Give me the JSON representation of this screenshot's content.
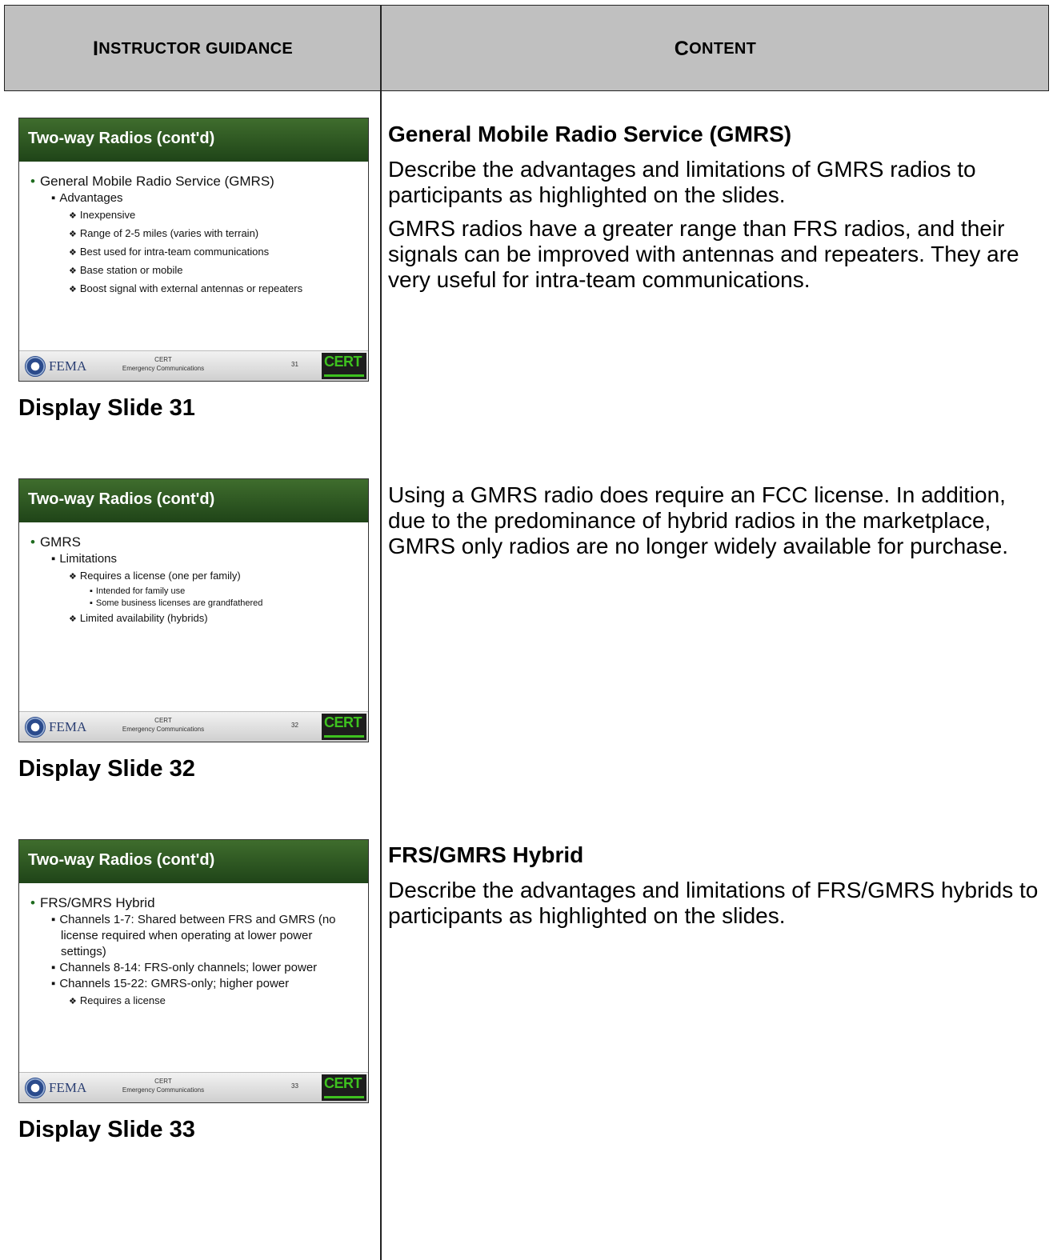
{
  "header": {
    "left": {
      "cap1": "I",
      "rest1": "nstructor guidance"
    },
    "right": {
      "cap1": "C",
      "rest1": "ontent"
    }
  },
  "slides": [
    {
      "title": "Two-way Radios (cont'd)",
      "bullets": [
        {
          "level": 1,
          "text": "General Mobile Radio Service (GMRS)"
        },
        {
          "level": 2,
          "text": "Advantages"
        },
        {
          "level": 3,
          "text": "Inexpensive"
        },
        {
          "level": 3,
          "text": "Range of 2-5 miles (varies with terrain)"
        },
        {
          "level": 3,
          "text": "Best used for intra-team communications"
        },
        {
          "level": 3,
          "text": "Base station or mobile"
        },
        {
          "level": 3,
          "text": "Boost signal with external antennas or repeaters"
        }
      ],
      "footer_fema": "FEMA",
      "footer_line1": "CERT",
      "footer_line2": "Emergency Communications",
      "page": "31",
      "logo": "CERT",
      "caption": "Display Slide 31"
    },
    {
      "title": "Two-way Radios (cont'd)",
      "bullets": [
        {
          "level": 1,
          "text": "GMRS"
        },
        {
          "level": 2,
          "text": "Limitations"
        },
        {
          "level": 3,
          "text": "Requires a license (one per family)"
        },
        {
          "level": 4,
          "text": "Intended for family use"
        },
        {
          "level": 4,
          "text": "Some business licenses are grandfathered"
        },
        {
          "level": 3,
          "text": "Limited availability (hybrids)"
        }
      ],
      "footer_fema": "FEMA",
      "footer_line1": "CERT",
      "footer_line2": "Emergency Communications",
      "page": "32",
      "logo": "CERT",
      "caption": "Display Slide 32"
    },
    {
      "title": "Two-way Radios (cont'd)",
      "bullets": [
        {
          "level": 1,
          "text": "FRS/GMRS Hybrid"
        },
        {
          "level": 2,
          "text": "Channels 1-7: Shared between FRS and GMRS (no license required when operating at lower power settings)"
        },
        {
          "level": 2,
          "text": "Channels 8-14: FRS-only channels; lower power"
        },
        {
          "level": 2,
          "text": "Channels 15-22: GMRS-only; higher power"
        },
        {
          "level": 3,
          "text": "Requires a license"
        }
      ],
      "footer_fema": "FEMA",
      "footer_line1": "CERT",
      "footer_line2": "Emergency Communications",
      "page": "33",
      "logo": "CERT",
      "caption": "Display Slide 33"
    }
  ],
  "content": [
    {
      "heading": "General Mobile Radio Service (GMRS)",
      "paragraphs": [
        "Describe the advantages and limitations of GMRS radios to participants as highlighted on the slides.",
        "GMRS radios have a greater range than FRS radios, and their signals can be improved with antennas and repeaters.  They are very useful for intra-team communications."
      ]
    },
    {
      "heading": "",
      "paragraphs": [
        "Using a GMRS radio does require an FCC license.  In addition, due to the predominance of hybrid radios in the marketplace, GMRS only radios are no longer widely available for purchase."
      ]
    },
    {
      "heading": "FRS/GMRS Hybrid",
      "paragraphs": [
        "Describe the advantages and limitations of FRS/GMRS hybrids to participants as highlighted on the slides."
      ]
    }
  ]
}
